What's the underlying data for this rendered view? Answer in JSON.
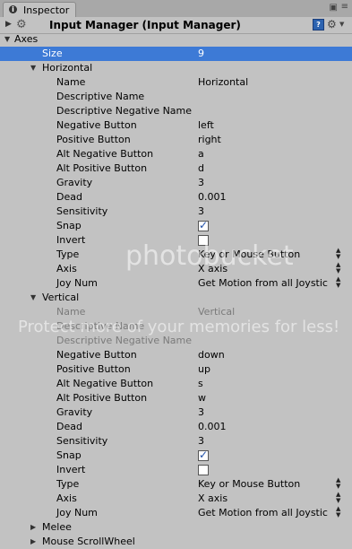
{
  "tab": {
    "label": "Inspector"
  },
  "header": {
    "title": "Input Manager (Input Manager)"
  },
  "axes": {
    "label": "Axes",
    "size_label": "Size",
    "size_value": "9"
  },
  "horizontal": {
    "name": "Horizontal",
    "fields": [
      {
        "label": "Name",
        "value": "Horizontal"
      },
      {
        "label": "Descriptive Name",
        "value": ""
      },
      {
        "label": "Descriptive Negative Name",
        "value": ""
      },
      {
        "label": "Negative Button",
        "value": "left"
      },
      {
        "label": "Positive Button",
        "value": "right"
      },
      {
        "label": "Alt Negative Button",
        "value": "a"
      },
      {
        "label": "Alt Positive Button",
        "value": "d"
      },
      {
        "label": "Gravity",
        "value": "3"
      },
      {
        "label": "Dead",
        "value": "0.001"
      },
      {
        "label": "Sensitivity",
        "value": "3"
      }
    ],
    "snap_label": "Snap",
    "snap_checked": true,
    "invert_label": "Invert",
    "invert_checked": false,
    "type_label": "Type",
    "type_value": "Key or Mouse Button",
    "axis_label": "Axis",
    "axis_value": "X axis",
    "joy_label": "Joy Num",
    "joy_value": "Get Motion from all Joystic"
  },
  "vertical": {
    "name": "Vertical",
    "fields": [
      {
        "label": "Name",
        "value": "Vertical"
      },
      {
        "label": "Descriptive Name",
        "value": ""
      },
      {
        "label": "Descriptive Negative Name",
        "value": ""
      },
      {
        "label": "Negative Button",
        "value": "down"
      },
      {
        "label": "Positive Button",
        "value": "up"
      },
      {
        "label": "Alt Negative Button",
        "value": "s"
      },
      {
        "label": "Alt Positive Button",
        "value": "w"
      },
      {
        "label": "Gravity",
        "value": "3"
      },
      {
        "label": "Dead",
        "value": "0.001"
      },
      {
        "label": "Sensitivity",
        "value": "3"
      }
    ],
    "snap_label": "Snap",
    "snap_checked": true,
    "invert_label": "Invert",
    "invert_checked": false,
    "type_label": "Type",
    "type_value": "Key or Mouse Button",
    "axis_label": "Axis",
    "axis_value": "X axis",
    "joy_label": "Joy Num",
    "joy_value": "Get Motion from all Joystic"
  },
  "melee": {
    "name": "Melee"
  },
  "mouse_scroll": {
    "name": "Mouse ScrollWheel"
  },
  "watermark": {
    "brand": "photobucket",
    "tagline": "Protect more of your memories for less!"
  },
  "icons": {
    "help": "help-icon",
    "settings": "gear-icon",
    "lock": "lock-icon"
  },
  "colors": {
    "selection": "#3d7ad6",
    "panel": "#c2c2c2"
  }
}
